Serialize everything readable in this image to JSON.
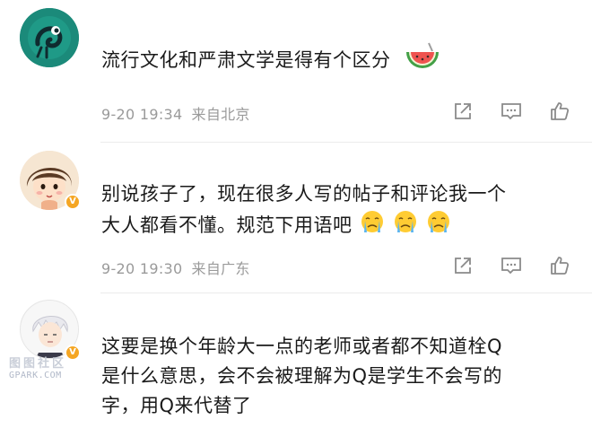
{
  "comments": [
    {
      "text_lines": [
        "流行文化和严肃文学是得有个区分"
      ],
      "emoji": "watermelon",
      "time": "9-20 19:34",
      "location": "来自北京",
      "avatar_icon": "chameleon-avatar",
      "verified": false
    },
    {
      "text_lines": [
        "别说孩子了，现在很多人写的帖子和评论我一个",
        "大人都看不懂。规范下用语吧"
      ],
      "emoji": "crying-face",
      "emoji_count": 3,
      "time": "9-20 19:30",
      "location": "来自广东",
      "avatar_icon": "girl-avatar",
      "verified": true
    },
    {
      "text_lines": [
        "这要是换个年龄大一点的老师或者都不知道栓Q",
        "是什么意思，会不会被理解为Q是学生不会写的",
        "字，用Q来代替了"
      ],
      "avatar_icon": "white-hair-avatar",
      "verified": true
    }
  ],
  "watermark": {
    "line1": "图图社区",
    "line2": "GPARK.COM"
  },
  "actions": [
    "share-icon",
    "comment-icon",
    "like-icon"
  ],
  "colors": {
    "verified_badge": "#f5a623",
    "meta_text": "#9a9a9a",
    "divider": "#ececec"
  }
}
